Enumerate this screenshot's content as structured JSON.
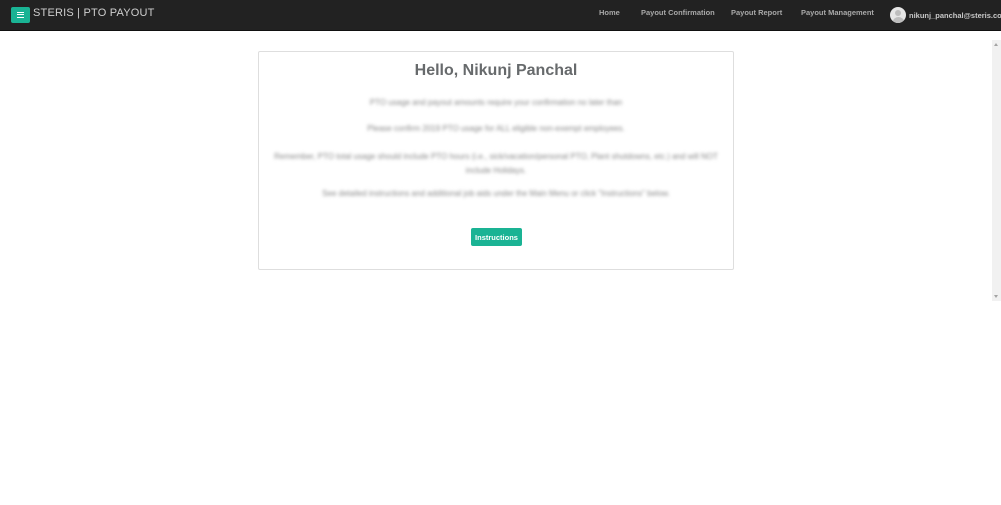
{
  "header": {
    "brand": "STERIS | PTO PAYOUT",
    "menu_icon": "hamburger-icon",
    "nav": {
      "home": "Home",
      "payout_confirmation": "Payout Confirmation",
      "payout_report": "Payout Report",
      "payout_management": "Payout Management"
    },
    "user_email": "nikunj_panchal@steris.com"
  },
  "main": {
    "greeting": "Hello, Nikunj Panchal",
    "paragraph1": "PTO usage and payout amounts require your confirmation no later than",
    "paragraph1_highlight": "",
    "paragraph2_highlight": "",
    "paragraph2": "Please confirm 2019 PTO usage for ALL eligible non-exempt employees.",
    "paragraph3": "Remember, PTO total usage should include PTO hours (i.e., sick/vacation/personal PTO, Plant shutdowns, etc.) and will NOT include Holidays.",
    "paragraph4": "See detailed instructions and additional job aids under the Main Menu or click \"Instructions\" below.",
    "instructions_button": "Instructions"
  },
  "colors": {
    "accent": "#1ab394",
    "navbar": "#222222"
  }
}
